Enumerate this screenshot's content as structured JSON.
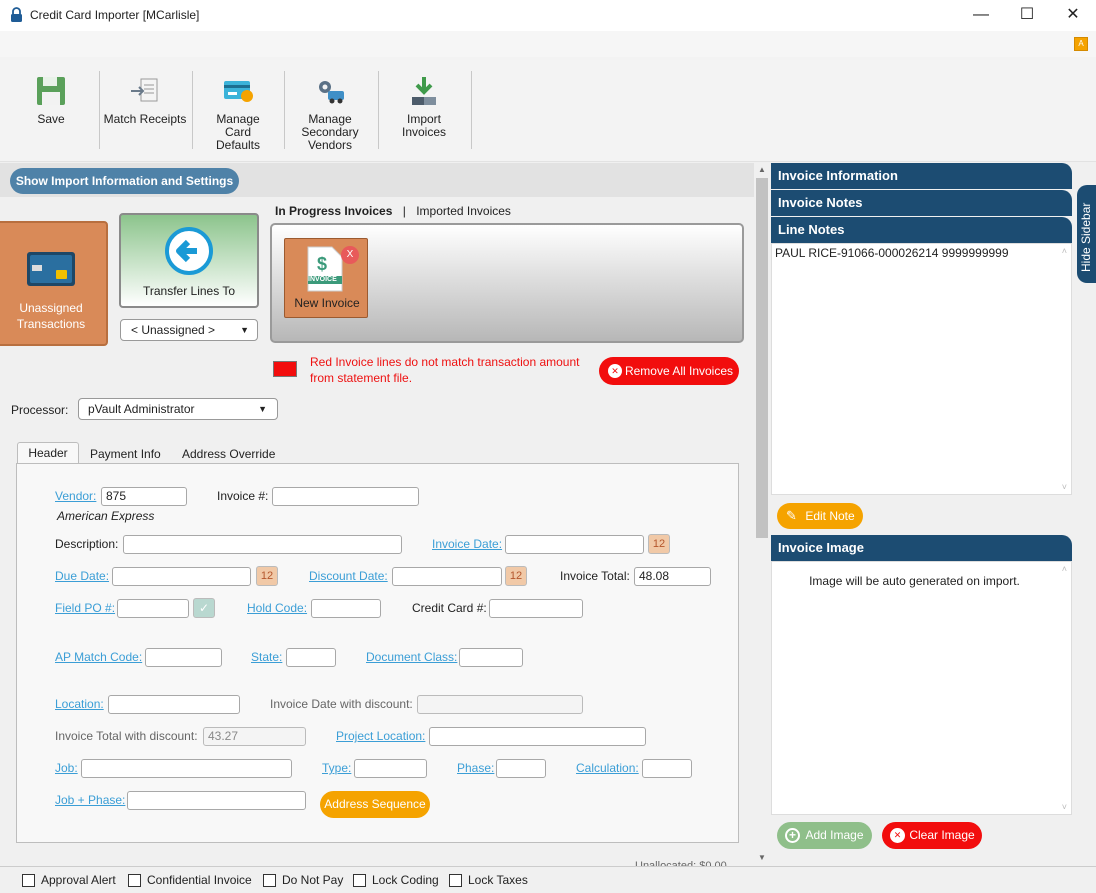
{
  "window": {
    "title": "Credit Card Importer [MCarlisle]"
  },
  "ribbon": {
    "buttons": [
      {
        "label": "Save",
        "icon": "save-icon"
      },
      {
        "label": "Match Receipts",
        "icon": "match-receipts-icon"
      },
      {
        "label": "Manage Card Defaults",
        "icon": "credit-card-icon"
      },
      {
        "label": "Manage Secondary Vendors",
        "icon": "vendors-icon"
      },
      {
        "label": "Import Invoices",
        "icon": "download-icon"
      }
    ]
  },
  "left": {
    "show_settings_label": "Show Import Information and Settings",
    "unassigned_label": "Unassigned Transactions",
    "transfer_label": "Transfer Lines To",
    "transfer_select": "< Unassigned >",
    "tabs": {
      "in_progress": "In Progress Invoices",
      "separator": "|",
      "imported": "Imported Invoices"
    },
    "invoice_tile": {
      "icon_text": "INVOICE",
      "label": "New Invoice",
      "close": "X"
    },
    "legend_text": "Red Invoice lines do not match transaction amount from statement file.",
    "remove_all_label": "Remove All Invoices",
    "processor_label": "Processor:",
    "processor_value": "pVault Administrator"
  },
  "form_tabs": [
    "Header",
    "Payment Info",
    "Address Override"
  ],
  "form": {
    "vendor_label": "Vendor:",
    "vendor_value": "875",
    "vendor_name": "American Express",
    "invoice_no_label": "Invoice #:",
    "invoice_no_value": "",
    "description_label": "Description:",
    "description_value": "",
    "invoice_date_label": "Invoice Date:",
    "invoice_date_value": "",
    "due_date_label": "Due Date:",
    "due_date_value": "",
    "discount_date_label": "Discount Date:",
    "discount_date_value": "",
    "invoice_total_label": "Invoice Total:",
    "invoice_total_value": "48.08",
    "field_po_label": "Field PO #:",
    "field_po_value": "",
    "hold_code_label": "Hold Code:",
    "hold_code_value": "",
    "credit_card_label": "Credit Card #:",
    "credit_card_value": "",
    "ap_match_label": "AP Match Code:",
    "ap_match_value": "",
    "state_label": "State:",
    "state_value": "",
    "doc_class_label": "Document Class:",
    "doc_class_value": "",
    "location_label": "Location:",
    "location_value": "",
    "inv_date_disc_label": "Invoice Date with discount:",
    "inv_date_disc_value": "",
    "inv_total_disc_label": "Invoice Total with discount:",
    "inv_total_disc_value": "43.27",
    "project_location_label": "Project Location:",
    "project_location_value": "",
    "job_label": "Job:",
    "job_value": "",
    "type_label": "Type:",
    "type_value": "",
    "phase_label": "Phase:",
    "phase_value": "",
    "calculation_label": "Calculation:",
    "calculation_value": "",
    "job_phase_label": "Job + Phase:",
    "job_phase_value": "",
    "address_sequence_label": "Address Sequence",
    "unallocated_text": "Unallocated:   $0.00"
  },
  "checkboxes": [
    "Approval Alert",
    "Confidential Invoice",
    "Do Not Pay",
    "Lock Coding",
    "Lock Taxes"
  ],
  "sidebar": {
    "invoice_information": "Invoice Information",
    "invoice_notes": "Invoice Notes",
    "line_notes": "Line Notes",
    "line_notes_text": "PAUL RICE-91066-000026214   9999999999",
    "edit_note_label": "Edit Note",
    "invoice_image": "Invoice Image",
    "image_text": "Image will be auto generated on import.",
    "add_image_label": "Add Image",
    "clear_image_label": "Clear Image",
    "hide_sidebar_label": "Hide Sidebar"
  },
  "colors": {
    "accent_orange": "#f5a300",
    "danger_red": "#f20d0d",
    "header_navy": "#1c4c72",
    "link_blue": "#3b9ed6",
    "tile_orange": "#d98a58",
    "add_green": "#8fbf8a"
  }
}
